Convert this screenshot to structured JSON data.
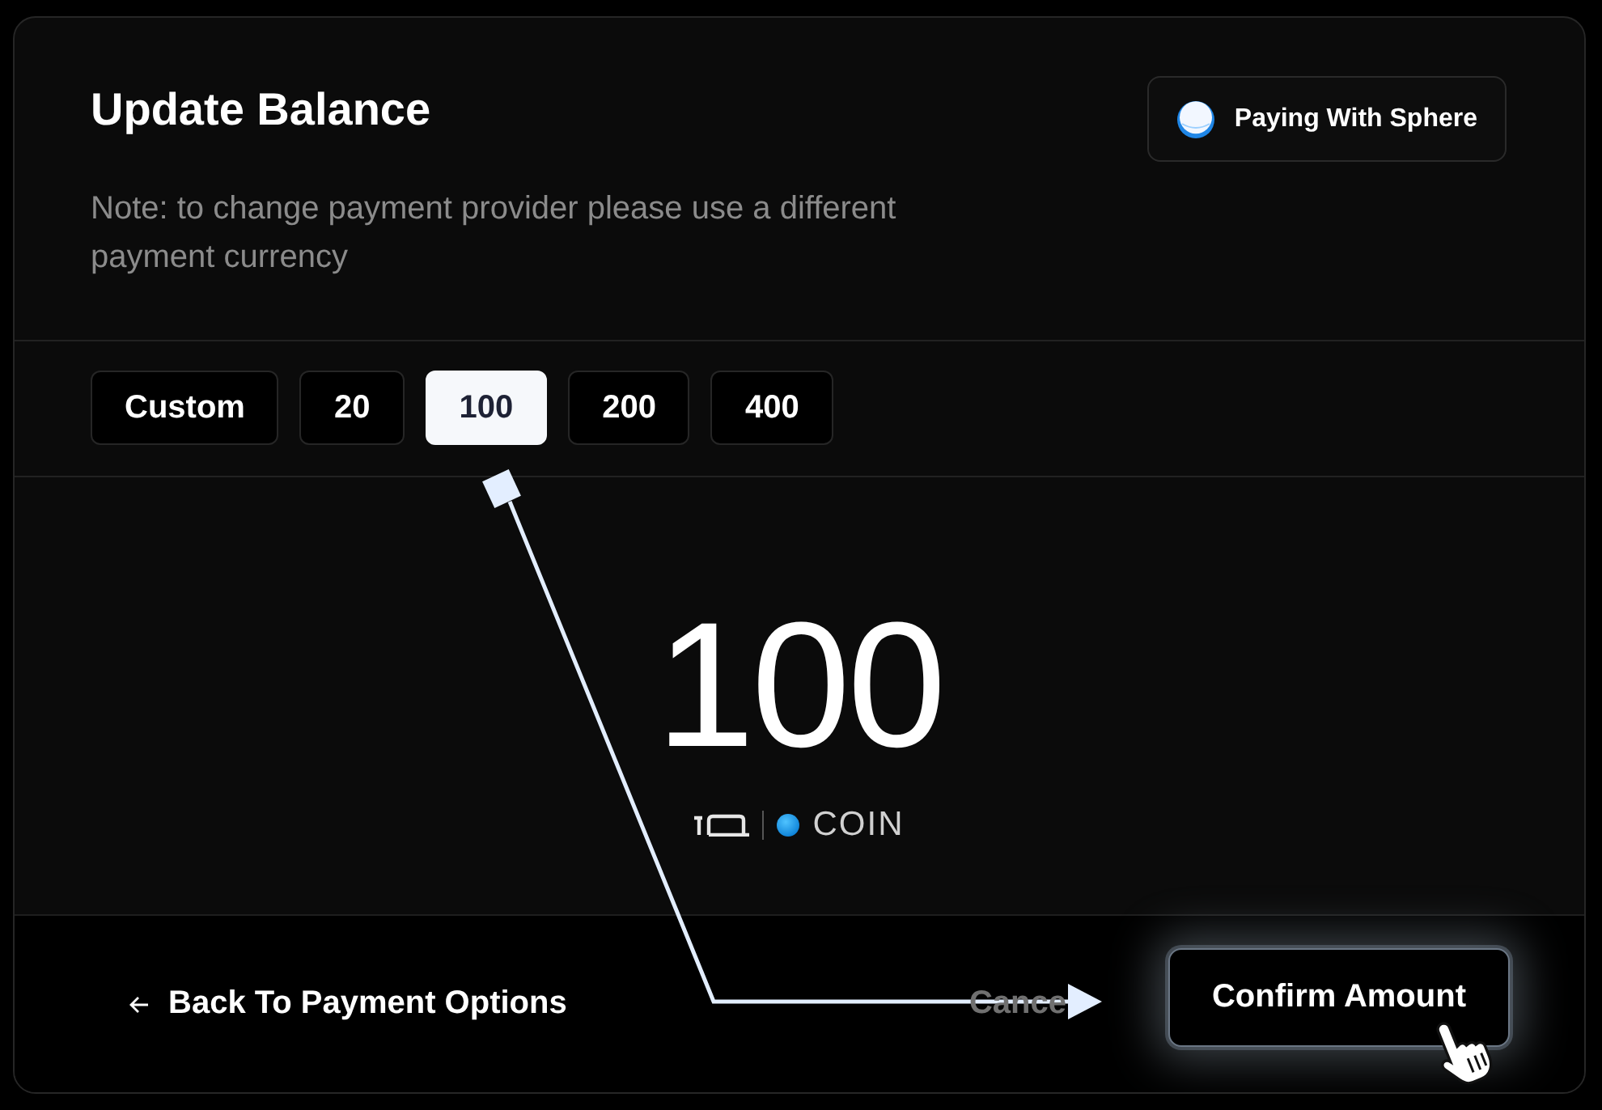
{
  "dialog": {
    "title": "Update Balance",
    "note": "Note: to change payment provider please use a different payment currency",
    "provider_button": {
      "label": "Paying With Sphere"
    }
  },
  "presets": [
    {
      "label": "Custom",
      "selected": false
    },
    {
      "label": "20",
      "selected": false
    },
    {
      "label": "100",
      "selected": true
    },
    {
      "label": "200",
      "selected": false
    },
    {
      "label": "400",
      "selected": false
    }
  ],
  "amount": {
    "value": "100",
    "currency": "COIN"
  },
  "footer": {
    "back_link": {
      "label": "Back To Payment Options"
    },
    "cancel_button": {
      "label": "Cance"
    },
    "confirm_button": {
      "label": "Confirm Amount",
      "highlighted": true
    }
  }
}
